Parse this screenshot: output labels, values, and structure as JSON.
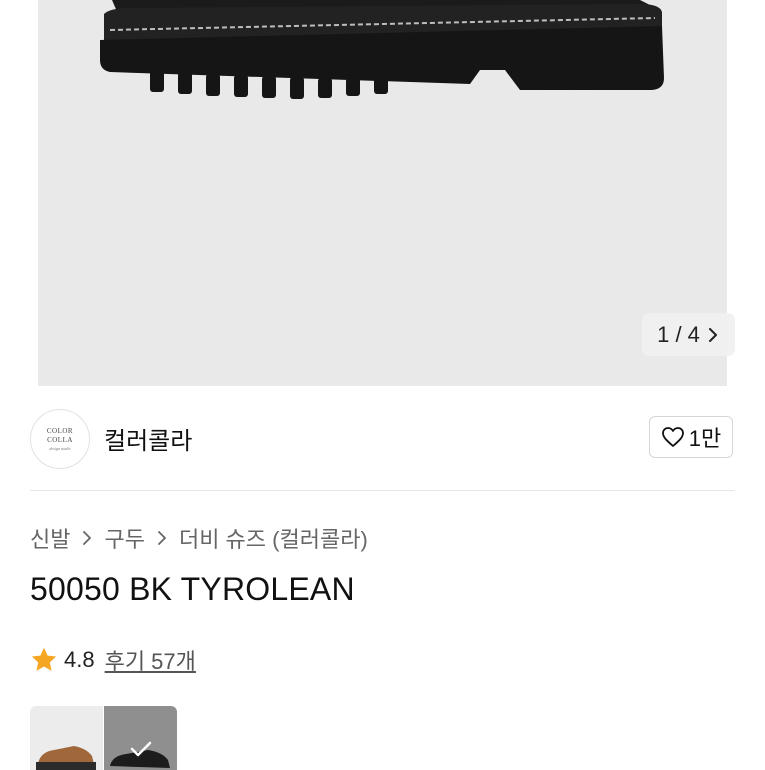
{
  "gallery": {
    "page_indicator": "1 / 4"
  },
  "brand": {
    "logo_line1": "COLOR",
    "logo_line2": "COLLA",
    "logo_line3": "design studio",
    "name": "컬러콜라",
    "like_count": "1만"
  },
  "breadcrumb": [
    "신발",
    "구두",
    "더비 슈즈 (컬러콜라)"
  ],
  "product": {
    "title": "50050 BK TYROLEAN",
    "rating": "4.8",
    "reviews": "후기 57개"
  },
  "colors": {
    "star": "#f5a623",
    "selected_overlay": "#8f8f8f"
  },
  "icons": [
    "chevron-right-icon",
    "heart-icon",
    "star-icon",
    "check-icon"
  ]
}
